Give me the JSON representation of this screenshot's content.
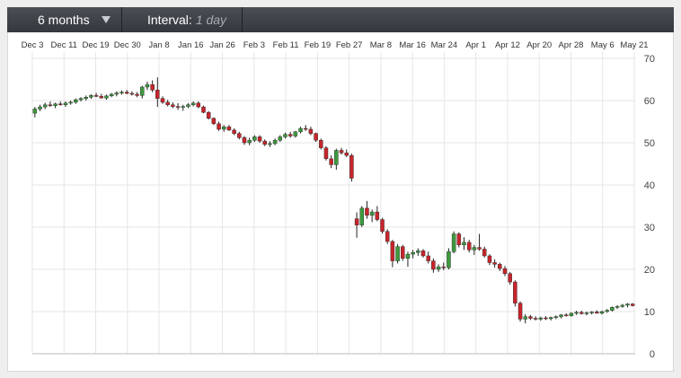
{
  "toolbar": {
    "period": "6 months",
    "interval_label": "Interval:",
    "interval_value": "1 day"
  },
  "colors": {
    "up": "#3d9a3d",
    "down": "#c8252c",
    "grid": "#e6e6e6",
    "toolbar": "#3b3f44"
  },
  "chart_data": {
    "type": "candlestick",
    "title": "",
    "xlabel": "",
    "ylabel": "",
    "ylim": [
      0,
      70
    ],
    "y_ticks": [
      0,
      10,
      20,
      30,
      40,
      50,
      60,
      70
    ],
    "y_axis_side": "right",
    "grid": true,
    "legend": "none",
    "x_ticks": [
      "Dec 3",
      "Dec 11",
      "Dec 19",
      "Dec 30",
      "Jan 8",
      "Jan 16",
      "Jan 26",
      "Feb 3",
      "Feb 11",
      "Feb 19",
      "Feb 27",
      "Mar 8",
      "Mar 16",
      "Mar 24",
      "Apr 1",
      "Apr 12",
      "Apr 20",
      "Apr 28",
      "May 6",
      "May 21"
    ],
    "candles": [
      {
        "date": "Dec 3",
        "o": 57,
        "h": 58.5,
        "l": 56,
        "c": 58
      },
      {
        "date": "Dec 4",
        "o": 58,
        "h": 59,
        "l": 57.5,
        "c": 58.5
      },
      {
        "date": "Dec 5",
        "o": 58.5,
        "h": 59.5,
        "l": 58,
        "c": 59
      },
      {
        "date": "Dec 6",
        "o": 59,
        "h": 59.8,
        "l": 58.5,
        "c": 58.8
      },
      {
        "date": "Dec 7",
        "o": 58.8,
        "h": 59.5,
        "l": 58.2,
        "c": 59.2
      },
      {
        "date": "Dec 10",
        "o": 59.2,
        "h": 59.8,
        "l": 58.8,
        "c": 59
      },
      {
        "date": "Dec 11",
        "o": 59,
        "h": 59.8,
        "l": 58.5,
        "c": 59.4
      },
      {
        "date": "Dec 12",
        "o": 59.4,
        "h": 60,
        "l": 59,
        "c": 59.6
      },
      {
        "date": "Dec 13",
        "o": 59.6,
        "h": 60.5,
        "l": 59.2,
        "c": 60.2
      },
      {
        "date": "Dec 14",
        "o": 60.2,
        "h": 60.8,
        "l": 59.8,
        "c": 60.5
      },
      {
        "date": "Dec 17",
        "o": 60.5,
        "h": 61.2,
        "l": 60,
        "c": 60.8
      },
      {
        "date": "Dec 18",
        "o": 60.8,
        "h": 61.5,
        "l": 60.4,
        "c": 61.2
      },
      {
        "date": "Dec 19",
        "o": 61.2,
        "h": 61.8,
        "l": 60.8,
        "c": 61
      },
      {
        "date": "Dec 20",
        "o": 61,
        "h": 61.6,
        "l": 60.5,
        "c": 60.6
      },
      {
        "date": "Dec 21",
        "o": 60.6,
        "h": 61.4,
        "l": 60.2,
        "c": 61.1
      },
      {
        "date": "Dec 24",
        "o": 61.1,
        "h": 61.8,
        "l": 60.8,
        "c": 61.5
      },
      {
        "date": "Dec 26",
        "o": 61.5,
        "h": 62.2,
        "l": 61,
        "c": 61.8
      },
      {
        "date": "Dec 27",
        "o": 61.8,
        "h": 62.4,
        "l": 61.4,
        "c": 62
      },
      {
        "date": "Dec 28",
        "o": 62,
        "h": 62.5,
        "l": 61.5,
        "c": 61.7
      },
      {
        "date": "Dec 31",
        "o": 61.7,
        "h": 62.2,
        "l": 61.2,
        "c": 61.5
      },
      {
        "date": "Jan 2",
        "o": 61.5,
        "h": 62,
        "l": 60.8,
        "c": 61.2
      },
      {
        "date": "Jan 3",
        "o": 61.2,
        "h": 63.5,
        "l": 60.5,
        "c": 63.2
      },
      {
        "date": "Jan 4",
        "o": 63.2,
        "h": 64.5,
        "l": 62.5,
        "c": 63.8
      },
      {
        "date": "Jan 7",
        "o": 63.8,
        "h": 64.8,
        "l": 62,
        "c": 62.5
      },
      {
        "date": "Jan 8",
        "o": 62.5,
        "h": 65.5,
        "l": 58.5,
        "c": 60.5
      },
      {
        "date": "Jan 9",
        "o": 60.5,
        "h": 61,
        "l": 59.2,
        "c": 59.6
      },
      {
        "date": "Jan 10",
        "o": 59.6,
        "h": 60.2,
        "l": 58.6,
        "c": 59
      },
      {
        "date": "Jan 11",
        "o": 59,
        "h": 59.6,
        "l": 58.2,
        "c": 58.6
      },
      {
        "date": "Jan 14",
        "o": 58.6,
        "h": 59.4,
        "l": 57.8,
        "c": 58.4
      },
      {
        "date": "Jan 15",
        "o": 58.4,
        "h": 59,
        "l": 57.6,
        "c": 58.6
      },
      {
        "date": "Jan 16",
        "o": 58.6,
        "h": 59.4,
        "l": 58.2,
        "c": 59
      },
      {
        "date": "Jan 17",
        "o": 59,
        "h": 59.8,
        "l": 58.6,
        "c": 59.4
      },
      {
        "date": "Jan 18",
        "o": 59.4,
        "h": 59.8,
        "l": 58.2,
        "c": 58.5
      },
      {
        "date": "Jan 22",
        "o": 58.5,
        "h": 58.8,
        "l": 57,
        "c": 57.2
      },
      {
        "date": "Jan 23",
        "o": 57.2,
        "h": 57.5,
        "l": 55.5,
        "c": 55.8
      },
      {
        "date": "Jan 24",
        "o": 55.8,
        "h": 56,
        "l": 54.2,
        "c": 54.5
      },
      {
        "date": "Jan 25",
        "o": 54.5,
        "h": 55,
        "l": 52.8,
        "c": 53.2
      },
      {
        "date": "Jan 28",
        "o": 53.2,
        "h": 54.2,
        "l": 52.6,
        "c": 53.8
      },
      {
        "date": "Jan 29",
        "o": 53.8,
        "h": 54.2,
        "l": 52.8,
        "c": 53
      },
      {
        "date": "Jan 30",
        "o": 53,
        "h": 53.4,
        "l": 51.8,
        "c": 52.2
      },
      {
        "date": "Jan 31",
        "o": 52.2,
        "h": 52.6,
        "l": 50.8,
        "c": 51.2
      },
      {
        "date": "Feb 1",
        "o": 51.2,
        "h": 51.6,
        "l": 49.5,
        "c": 50
      },
      {
        "date": "Feb 4",
        "o": 50,
        "h": 51.2,
        "l": 49.4,
        "c": 50.6
      },
      {
        "date": "Feb 5",
        "o": 50.6,
        "h": 51.8,
        "l": 50.2,
        "c": 51.4
      },
      {
        "date": "Feb 6",
        "o": 51.4,
        "h": 51.8,
        "l": 50,
        "c": 50.4
      },
      {
        "date": "Feb 7",
        "o": 50.4,
        "h": 50.8,
        "l": 49.2,
        "c": 49.6
      },
      {
        "date": "Feb 8",
        "o": 49.6,
        "h": 50.4,
        "l": 49,
        "c": 49.8
      },
      {
        "date": "Feb 11",
        "o": 49.8,
        "h": 51,
        "l": 49.4,
        "c": 50.6
      },
      {
        "date": "Feb 12",
        "o": 50.6,
        "h": 51.8,
        "l": 50.2,
        "c": 51.4
      },
      {
        "date": "Feb 13",
        "o": 51.4,
        "h": 52.4,
        "l": 51,
        "c": 52
      },
      {
        "date": "Feb 14",
        "o": 52,
        "h": 52.6,
        "l": 51.2,
        "c": 51.6
      },
      {
        "date": "Feb 15",
        "o": 51.6,
        "h": 52.8,
        "l": 51.2,
        "c": 52.6
      },
      {
        "date": "Feb 19",
        "o": 52.6,
        "h": 53.8,
        "l": 52.2,
        "c": 53.4
      },
      {
        "date": "Feb 20",
        "o": 53.4,
        "h": 54.2,
        "l": 52.8,
        "c": 53.2
      },
      {
        "date": "Feb 21",
        "o": 53.2,
        "h": 53.8,
        "l": 51.8,
        "c": 52.2
      },
      {
        "date": "Feb 22",
        "o": 52.2,
        "h": 52.4,
        "l": 50.2,
        "c": 50.6
      },
      {
        "date": "Feb 25",
        "o": 50.6,
        "h": 51,
        "l": 48.4,
        "c": 48.8
      },
      {
        "date": "Feb 26",
        "o": 48.8,
        "h": 49.2,
        "l": 45.8,
        "c": 46.2
      },
      {
        "date": "Feb 27",
        "o": 46.2,
        "h": 47,
        "l": 44,
        "c": 44.8
      },
      {
        "date": "Feb 28",
        "o": 44.8,
        "h": 48.6,
        "l": 43.6,
        "c": 48.2
      },
      {
        "date": "Mar 1",
        "o": 48.2,
        "h": 48.8,
        "l": 47.2,
        "c": 47.6
      },
      {
        "date": "Mar 4",
        "o": 47.6,
        "h": 48.4,
        "l": 46.6,
        "c": 47
      },
      {
        "date": "Mar 5",
        "o": 47,
        "h": 47.4,
        "l": 40.8,
        "c": 41.6
      },
      {
        "date": "Mar 6",
        "o": 32,
        "h": 33.5,
        "l": 27.5,
        "c": 30.5
      },
      {
        "date": "Mar 7",
        "o": 30.5,
        "h": 35,
        "l": 30,
        "c": 34.5
      },
      {
        "date": "Mar 8",
        "o": 34.5,
        "h": 36.2,
        "l": 32,
        "c": 32.8
      },
      {
        "date": "Mar 11",
        "o": 32.8,
        "h": 34.2,
        "l": 31.2,
        "c": 33.6
      },
      {
        "date": "Mar 12",
        "o": 33.6,
        "h": 35,
        "l": 31.4,
        "c": 31.8
      },
      {
        "date": "Mar 13",
        "o": 31.8,
        "h": 32.2,
        "l": 28.5,
        "c": 29
      },
      {
        "date": "Mar 14",
        "o": 29,
        "h": 29.5,
        "l": 26,
        "c": 26.6
      },
      {
        "date": "Mar 15",
        "o": 26.6,
        "h": 27,
        "l": 20.5,
        "c": 22
      },
      {
        "date": "Mar 18",
        "o": 22,
        "h": 26,
        "l": 21.4,
        "c": 25.4
      },
      {
        "date": "Mar 19",
        "o": 25.4,
        "h": 25.8,
        "l": 22,
        "c": 22.6
      },
      {
        "date": "Mar 20",
        "o": 22.6,
        "h": 24.2,
        "l": 20.6,
        "c": 23.6
      },
      {
        "date": "Mar 21",
        "o": 23.6,
        "h": 24.6,
        "l": 22.6,
        "c": 24
      },
      {
        "date": "Mar 22",
        "o": 24,
        "h": 25,
        "l": 23.2,
        "c": 24.4
      },
      {
        "date": "Mar 25",
        "o": 24.4,
        "h": 24.8,
        "l": 22.8,
        "c": 23.2
      },
      {
        "date": "Mar 26",
        "o": 23.2,
        "h": 24.2,
        "l": 21.4,
        "c": 22
      },
      {
        "date": "Mar 27",
        "o": 22,
        "h": 22.6,
        "l": 19.2,
        "c": 20
      },
      {
        "date": "Mar 28",
        "o": 20,
        "h": 21.2,
        "l": 19.4,
        "c": 20.6
      },
      {
        "date": "Mar 29",
        "o": 20.6,
        "h": 21.6,
        "l": 19.8,
        "c": 20.4
      },
      {
        "date": "Apr 1",
        "o": 20.4,
        "h": 25,
        "l": 20,
        "c": 24.2
      },
      {
        "date": "Apr 2",
        "o": 24.2,
        "h": 29,
        "l": 23.8,
        "c": 28.4
      },
      {
        "date": "Apr 3",
        "o": 28.4,
        "h": 28.8,
        "l": 25.2,
        "c": 25.8
      },
      {
        "date": "Apr 4",
        "o": 25.8,
        "h": 27.6,
        "l": 24.6,
        "c": 26.4
      },
      {
        "date": "Apr 5",
        "o": 26.4,
        "h": 27,
        "l": 24,
        "c": 24.6
      },
      {
        "date": "Apr 8",
        "o": 24.6,
        "h": 25.8,
        "l": 23.4,
        "c": 25.2
      },
      {
        "date": "Apr 9",
        "o": 25.2,
        "h": 28.4,
        "l": 24.4,
        "c": 24.8
      },
      {
        "date": "Apr 10",
        "o": 24.8,
        "h": 25.4,
        "l": 22.8,
        "c": 23.2
      },
      {
        "date": "Apr 11",
        "o": 23.2,
        "h": 23.6,
        "l": 21,
        "c": 21.6
      },
      {
        "date": "Apr 12",
        "o": 21.6,
        "h": 22.4,
        "l": 20.4,
        "c": 21.2
      },
      {
        "date": "Apr 15",
        "o": 21.2,
        "h": 21.6,
        "l": 19.6,
        "c": 20.2
      },
      {
        "date": "Apr 16",
        "o": 20.2,
        "h": 20.8,
        "l": 18.4,
        "c": 19
      },
      {
        "date": "Apr 17",
        "o": 19,
        "h": 19.4,
        "l": 16.4,
        "c": 17
      },
      {
        "date": "Apr 18",
        "o": 17,
        "h": 17.4,
        "l": 11.2,
        "c": 12
      },
      {
        "date": "Apr 22",
        "o": 12,
        "h": 12.4,
        "l": 7.6,
        "c": 8.2
      },
      {
        "date": "Apr 23",
        "o": 8.2,
        "h": 9.4,
        "l": 7.2,
        "c": 8.8
      },
      {
        "date": "Apr 24",
        "o": 8.8,
        "h": 9.2,
        "l": 8,
        "c": 8.4
      },
      {
        "date": "Apr 25",
        "o": 8.4,
        "h": 8.9,
        "l": 7.9,
        "c": 8.2
      },
      {
        "date": "Apr 26",
        "o": 8.2,
        "h": 8.8,
        "l": 7.8,
        "c": 8.5
      },
      {
        "date": "Apr 29",
        "o": 8.5,
        "h": 8.9,
        "l": 8,
        "c": 8.3
      },
      {
        "date": "Apr 30",
        "o": 8.3,
        "h": 8.8,
        "l": 7.9,
        "c": 8.6
      },
      {
        "date": "May 1",
        "o": 8.6,
        "h": 9.1,
        "l": 8.2,
        "c": 8.8
      },
      {
        "date": "May 2",
        "o": 8.8,
        "h": 9.4,
        "l": 8.4,
        "c": 9.2
      },
      {
        "date": "May 3",
        "o": 9.2,
        "h": 9.6,
        "l": 8.8,
        "c": 9.0
      },
      {
        "date": "May 6",
        "o": 9.0,
        "h": 9.8,
        "l": 8.8,
        "c": 9.6
      },
      {
        "date": "May 7",
        "o": 9.6,
        "h": 10.2,
        "l": 9.2,
        "c": 9.8
      },
      {
        "date": "May 8",
        "o": 9.8,
        "h": 10.2,
        "l": 9.3,
        "c": 9.5
      },
      {
        "date": "May 9",
        "o": 9.5,
        "h": 10,
        "l": 9.1,
        "c": 9.7
      },
      {
        "date": "May 10",
        "o": 9.7,
        "h": 10.1,
        "l": 9.3,
        "c": 9.9
      },
      {
        "date": "May 13",
        "o": 9.9,
        "h": 10.3,
        "l": 9.5,
        "c": 9.6
      },
      {
        "date": "May 14",
        "o": 9.6,
        "h": 10.2,
        "l": 9.3,
        "c": 10
      },
      {
        "date": "May 15",
        "o": 10,
        "h": 10.6,
        "l": 9.7,
        "c": 10.3
      },
      {
        "date": "May 16",
        "o": 10.3,
        "h": 11.2,
        "l": 10,
        "c": 11
      },
      {
        "date": "May 17",
        "o": 11,
        "h": 11.5,
        "l": 10.6,
        "c": 11.2
      },
      {
        "date": "May 20",
        "o": 11.2,
        "h": 11.8,
        "l": 10.9,
        "c": 11.5
      },
      {
        "date": "May 21",
        "o": 11.5,
        "h": 12,
        "l": 11,
        "c": 11.8
      },
      {
        "date": "May 22",
        "o": 11.8,
        "h": 12,
        "l": 11.2,
        "c": 11.4
      }
    ]
  }
}
